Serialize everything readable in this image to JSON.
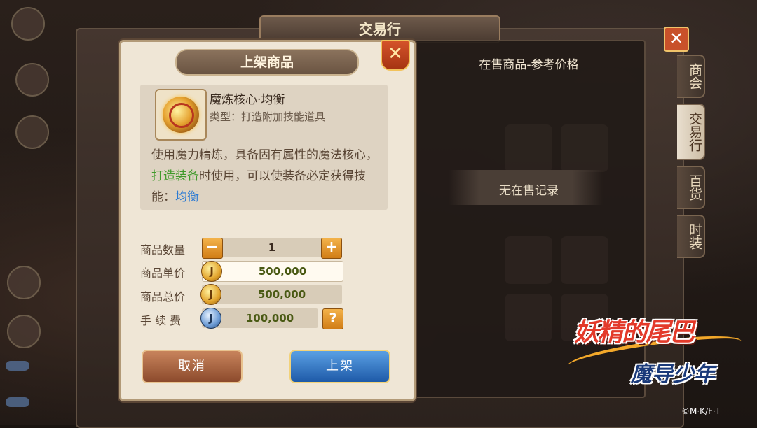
{
  "background": {
    "window_title": "交易行",
    "side_tabs": [
      "商会",
      "交易行",
      "百货",
      "时装"
    ],
    "active_side_tab": 1
  },
  "listing_panel": {
    "title": "上架商品",
    "item": {
      "name": "魔炼核心·均衡",
      "type": "类型：打造附加技能道具"
    },
    "description": {
      "part1": "使用魔力精炼，具备固有属性的魔法核心，",
      "highlight_green": "打造装备",
      "part2": "时使用，可以使装备必定获得技能：",
      "highlight_blue": "均衡"
    },
    "form": {
      "quantity_label": "商品数量",
      "quantity_value": "1",
      "unit_price_label": "商品单价",
      "unit_price_value": "500,000",
      "total_price_label": "商品总价",
      "total_price_value": "500,000",
      "fee_label": "手 续 费",
      "fee_value": "100,000"
    },
    "buttons": {
      "cancel": "取消",
      "list": "上架"
    }
  },
  "reference_panel": {
    "title": "在售商品-参考价格",
    "empty_text": "无在售记录"
  },
  "logo": {
    "main": "妖精的尾巴",
    "sub": "魔导少年"
  },
  "copyright": "©M·K/F·T",
  "colors": {
    "green_highlight": "#3f9a2a",
    "blue_highlight": "#2a7ad4",
    "gold_button": "#d17d16",
    "blue_button": "#1e5aa8",
    "close_button": "#c8512a"
  }
}
